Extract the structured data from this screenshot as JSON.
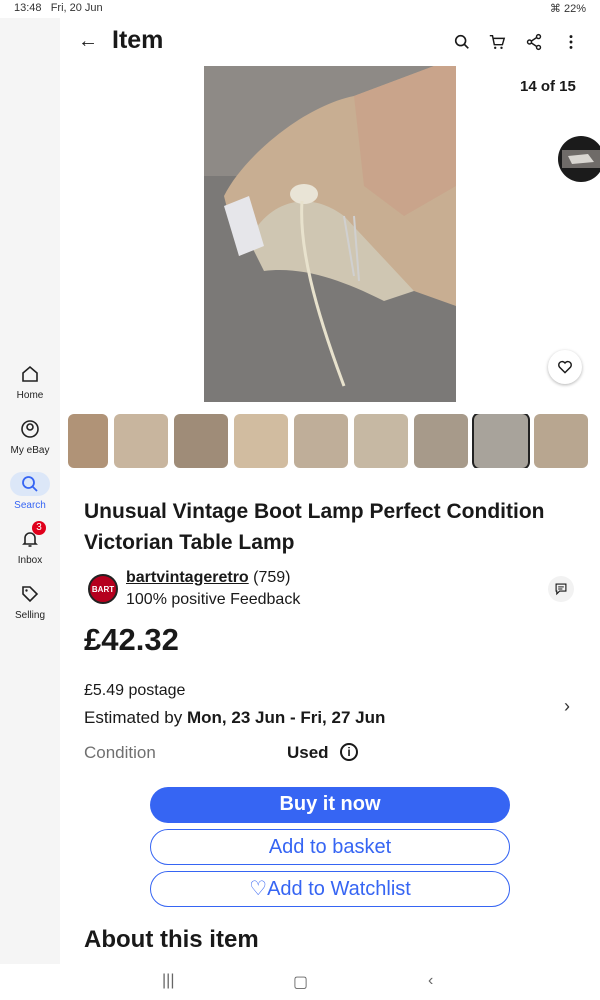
{
  "status": {
    "time": "13:48",
    "date": "Fri, 20 Jun",
    "battery": "22%"
  },
  "sidebar": {
    "items": [
      {
        "label": "Home",
        "icon": "home-icon"
      },
      {
        "label": "My eBay",
        "icon": "account-icon"
      },
      {
        "label": "Search",
        "icon": "search-icon",
        "active": true
      },
      {
        "label": "Inbox",
        "icon": "bell-icon",
        "badge": "3"
      },
      {
        "label": "Selling",
        "icon": "tag-icon"
      }
    ]
  },
  "header": {
    "title": "Item"
  },
  "gallery": {
    "counter": "14 of 15"
  },
  "product": {
    "title": "Unusual Vintage Boot Lamp Perfect Condition Victorian Table Lamp",
    "seller": {
      "name": "bartvintageretro",
      "count": "(759)",
      "feedback": "100% positive Feedback",
      "logo_text": "BART"
    },
    "price": "£42.32",
    "postage": "£5.49 postage",
    "estimated_prefix": "Estimated by ",
    "estimated_dates": "Mon, 23 Jun - Fri, 27 Jun",
    "condition_label": "Condition",
    "condition_value": "Used"
  },
  "actions": {
    "buy": "Buy it now",
    "basket": "Add to basket",
    "watchlist": "Add to Watchlist"
  },
  "about": {
    "heading": "About this item"
  },
  "colors": {
    "accent": "#3665f3",
    "badge": "#e0001b"
  }
}
